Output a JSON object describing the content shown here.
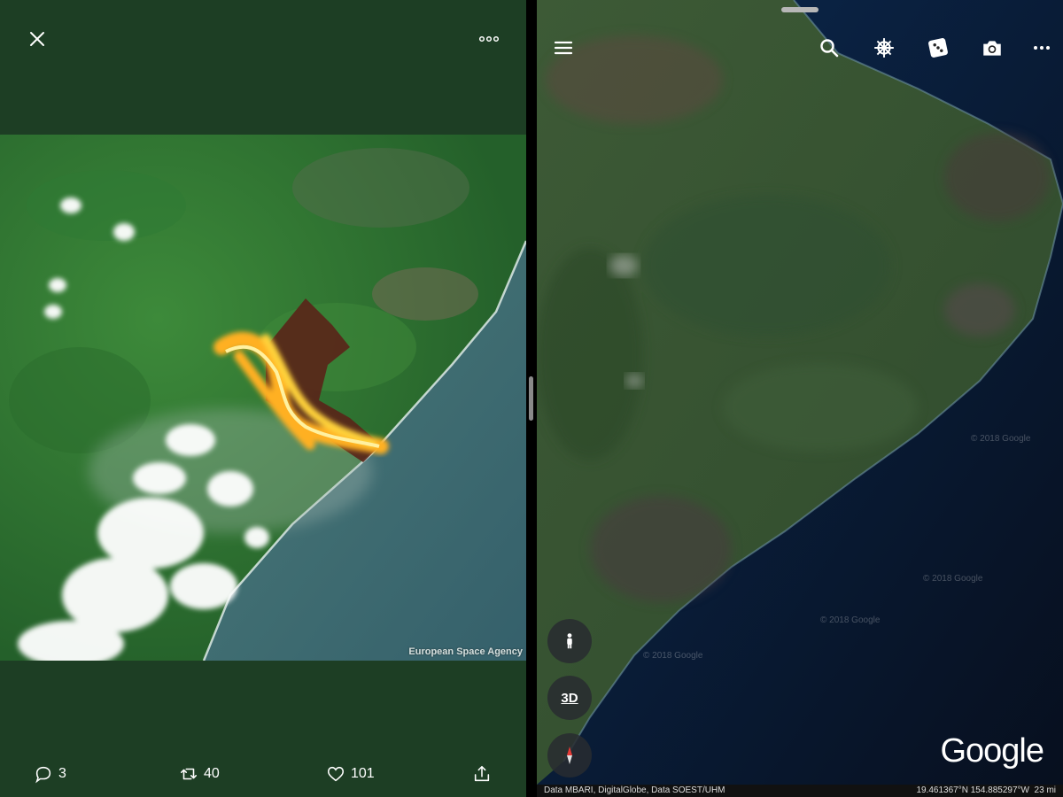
{
  "left_pane": {
    "photo_credit": "European Space Agency",
    "actions": {
      "replies": "3",
      "retweets": "40",
      "likes": "101"
    }
  },
  "right_pane": {
    "buttons": {
      "street_view": "street-view-icon",
      "mode_3d": "3D",
      "compass": "compass-icon"
    },
    "logo": "Google",
    "attribution": "Data MBARI, DigitalGlobe, Data SOEST/UHM",
    "coordinates": "19.461367°N 154.885297°W",
    "scale": "23 mi",
    "watermarks": [
      "© 2018 Google",
      "© 2018 Google",
      "© 2018 Google",
      "© 2018 Google"
    ]
  },
  "colors": {
    "twitter_bg": "#1d3e24",
    "lava": "#ffb020",
    "ocean": "#0a2a55"
  }
}
